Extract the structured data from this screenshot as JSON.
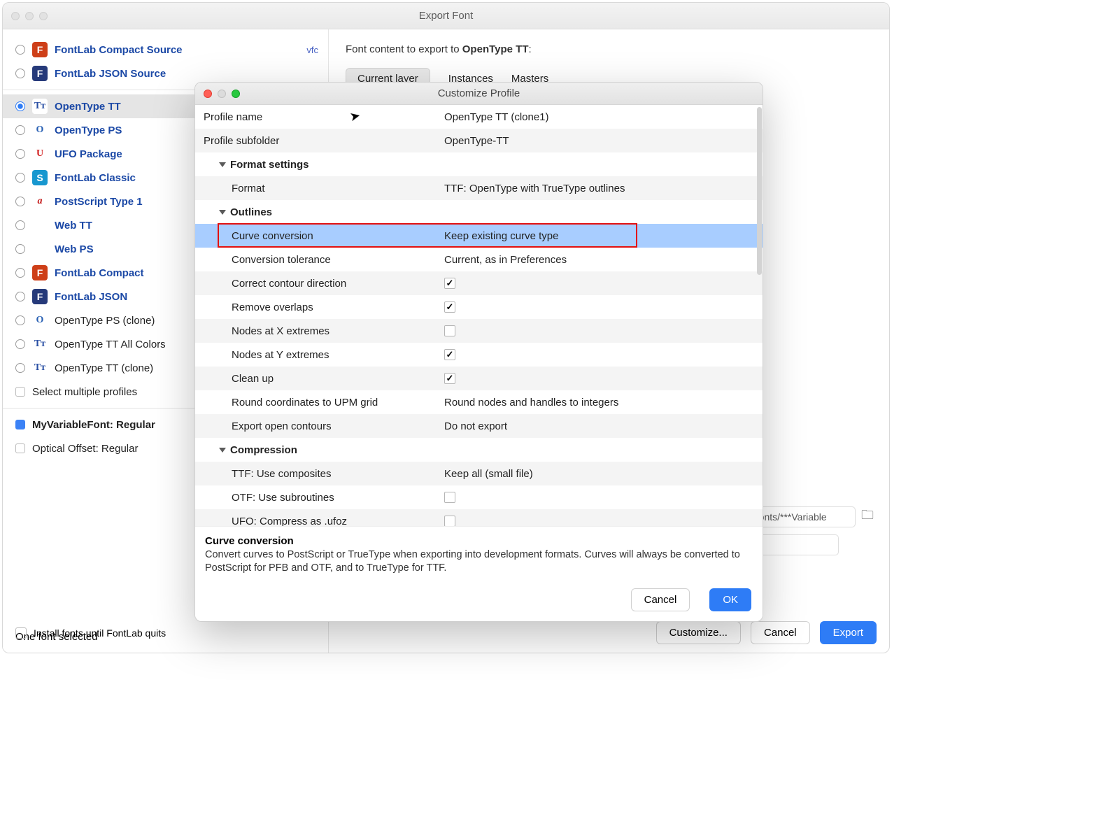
{
  "exportWindow": {
    "title": "Export Font",
    "profiles": [
      {
        "label": "FontLab Compact Source",
        "ext": "vfc",
        "icon": "F",
        "iconClass": "ic-f-orange",
        "bold": true
      },
      {
        "label": "FontLab JSON Source",
        "ext": "",
        "icon": "F",
        "iconClass": "ic-f-blue",
        "bold": true
      }
    ],
    "profiles2": [
      {
        "label": "OpenType TT",
        "icon": "Tᴛ",
        "iconClass": "ic-tt",
        "bold": true,
        "selected": true
      },
      {
        "label": "OpenType PS",
        "icon": "O",
        "iconClass": "ic-o",
        "bold": true
      },
      {
        "label": "UFO Package",
        "icon": "U",
        "iconClass": "ic-u",
        "bold": true
      },
      {
        "label": "FontLab Classic",
        "icon": "S",
        "iconClass": "ic-s",
        "bold": true
      },
      {
        "label": "PostScript Type 1",
        "icon": "a",
        "iconClass": "ic-a",
        "bold": true
      },
      {
        "label": "Web TT",
        "icon": "</>",
        "iconClass": "ic-web",
        "bold": true
      },
      {
        "label": "Web PS",
        "icon": "</>",
        "iconClass": "ic-web",
        "bold": true
      },
      {
        "label": "FontLab Compact",
        "icon": "F",
        "iconClass": "ic-f-orange",
        "bold": true
      },
      {
        "label": "FontLab JSON",
        "icon": "F",
        "iconClass": "ic-f-blue",
        "bold": true
      },
      {
        "label": "OpenType PS (clone)",
        "icon": "O",
        "iconClass": "ic-o",
        "bold": false
      },
      {
        "label": "OpenType TT All Colors",
        "icon": "Tᴛ",
        "iconClass": "ic-tt",
        "bold": false
      },
      {
        "label": "OpenType TT (clone)",
        "icon": "Tᴛ",
        "iconClass": "ic-tt",
        "bold": false
      }
    ],
    "selectMultiple": "Select multiple profiles",
    "fonts": [
      {
        "label": "MyVariableFont: Regular",
        "checked": true,
        "bold": true
      },
      {
        "label": "Optical Offset: Regular",
        "checked": false,
        "bold": false
      }
    ],
    "contentTo": {
      "prefix": "Font content to export to ",
      "target": "OpenType TT",
      "suffix": ":"
    },
    "tabs": [
      "Current layer",
      "Instances",
      "Masters"
    ],
    "pathValue": "st fonts/***Variable",
    "oneFontSelected": "One font selected",
    "installLabel": "Install fonts until FontLab quits",
    "buttons": {
      "customize": "Customize...",
      "cancel": "Cancel",
      "export": "Export"
    }
  },
  "dialog": {
    "title": "Customize Profile",
    "rows": [
      {
        "type": "kv",
        "key": "Profile name",
        "val": "OpenType TT (clone1)",
        "indent": 0,
        "alt": false
      },
      {
        "type": "kv",
        "key": "Profile subfolder",
        "val": "OpenType-TT",
        "indent": 0,
        "alt": true
      },
      {
        "type": "header",
        "key": "Format settings",
        "alt": false
      },
      {
        "type": "kv",
        "key": "Format",
        "val": "TTF: OpenType with TrueType outlines",
        "indent": 2,
        "alt": true
      },
      {
        "type": "header",
        "key": "Outlines",
        "alt": false
      },
      {
        "type": "kv",
        "key": "Curve conversion",
        "val": "Keep existing curve type",
        "indent": 2,
        "alt": true,
        "highlight": true
      },
      {
        "type": "kv",
        "key": "Conversion tolerance",
        "val": "Current, as in Preferences",
        "indent": 2,
        "alt": false
      },
      {
        "type": "chk",
        "key": "Correct contour direction",
        "checked": true,
        "indent": 2,
        "alt": true
      },
      {
        "type": "chk",
        "key": "Remove overlaps",
        "checked": true,
        "indent": 2,
        "alt": false
      },
      {
        "type": "chk",
        "key": "Nodes at X extremes",
        "checked": false,
        "indent": 2,
        "alt": true
      },
      {
        "type": "chk",
        "key": "Nodes at Y extremes",
        "checked": true,
        "indent": 2,
        "alt": false
      },
      {
        "type": "chk",
        "key": "Clean up",
        "checked": true,
        "indent": 2,
        "alt": true
      },
      {
        "type": "kv",
        "key": "Round coordinates to UPM grid",
        "val": "Round nodes and handles to integers",
        "indent": 2,
        "alt": false
      },
      {
        "type": "kv",
        "key": "Export open contours",
        "val": "Do not export",
        "indent": 2,
        "alt": true
      },
      {
        "type": "header",
        "key": "Compression",
        "alt": false
      },
      {
        "type": "kv",
        "key": "TTF: Use composites",
        "val": "Keep all (small file)",
        "indent": 2,
        "alt": true
      },
      {
        "type": "chk",
        "key": "OTF: Use subroutines",
        "checked": false,
        "indent": 2,
        "alt": false
      },
      {
        "type": "chk",
        "key": "UFO: Compress as .ufoz",
        "checked": false,
        "indent": 2,
        "alt": true
      }
    ],
    "help": {
      "title": "Curve conversion",
      "text": "Convert curves to PostScript or TrueType when exporting into development formats. Curves will always be converted to PostScript for PFB and OTF, and to TrueType for TTF."
    },
    "buttons": {
      "cancel": "Cancel",
      "ok": "OK"
    }
  }
}
